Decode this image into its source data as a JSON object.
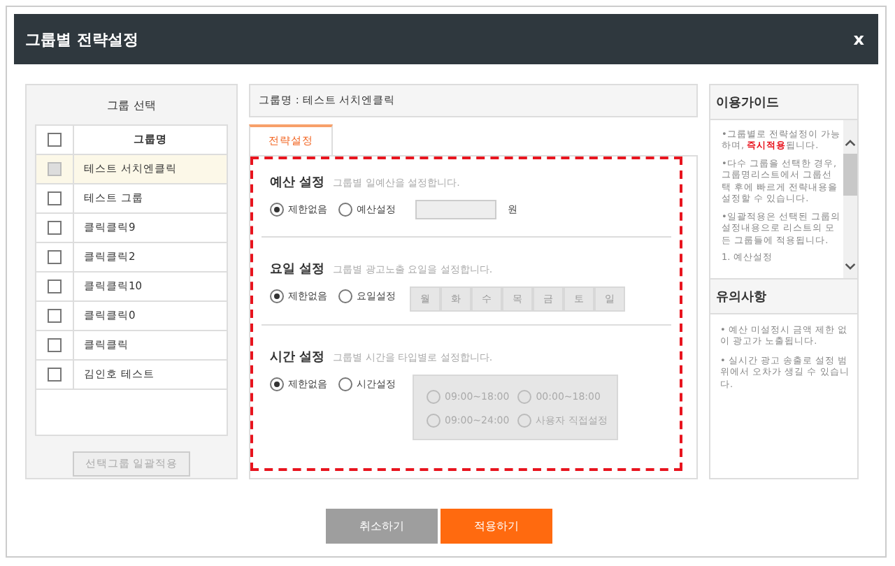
{
  "window": {
    "title": "그룹별 전략설정",
    "close": "x"
  },
  "group_panel": {
    "title": "그룹 선택",
    "header_checked": false,
    "column": "그룹명",
    "rows": [
      {
        "name": "테스트 서치엔클릭",
        "selected": true,
        "checked": false
      },
      {
        "name": "테스트 그룹",
        "selected": false,
        "checked": false
      },
      {
        "name": "클릭클릭9",
        "selected": false,
        "checked": false
      },
      {
        "name": "클릭클릭2",
        "selected": false,
        "checked": false
      },
      {
        "name": "클릭클릭10",
        "selected": false,
        "checked": false
      },
      {
        "name": "클릭클릭0",
        "selected": false,
        "checked": false
      },
      {
        "name": "클릭클릭",
        "selected": false,
        "checked": false
      },
      {
        "name": "김인호 테스트",
        "selected": false,
        "checked": false
      }
    ],
    "apply_button": {
      "label": "선택그룹 일괄적용",
      "disabled": true
    }
  },
  "strategy": {
    "group_name": "그룹명 : 테스트 서치엔클릭",
    "tabs": [
      {
        "label": "전략설정",
        "selected": true
      }
    ],
    "sections": [
      {
        "kind": "budget",
        "title": "예산 설정",
        "hint": "그룹별 일예산을 설정합니다.",
        "options": [
          {
            "label": "제한없음",
            "selected": true
          },
          {
            "label": "예산설정",
            "selected": false
          }
        ],
        "unit": "원"
      },
      {
        "kind": "days",
        "title": "요일 설정",
        "hint": "그룹별 광고노출 요일을 설정합니다.",
        "options": [
          {
            "label": "제한없음",
            "selected": true
          },
          {
            "label": "요일설정",
            "selected": false
          }
        ],
        "days": [
          {
            "label": "월",
            "selected": false
          },
          {
            "label": "화",
            "selected": false
          },
          {
            "label": "수",
            "selected": false
          },
          {
            "label": "목",
            "selected": false
          },
          {
            "label": "금",
            "selected": false
          },
          {
            "label": "토",
            "selected": false
          },
          {
            "label": "일",
            "selected": false
          }
        ]
      },
      {
        "kind": "time",
        "title": "시간 설정",
        "hint": "그룹별 시간을 타입별로 설정합니다.",
        "options": [
          {
            "label": "제한없음",
            "selected": true
          },
          {
            "label": "시간설정",
            "selected": false
          }
        ],
        "time_options": [
          {
            "label": "09:00~18:00",
            "selected": false
          },
          {
            "label": "00:00~18:00",
            "selected": false
          },
          {
            "label": "09:00~24:00",
            "selected": false
          },
          {
            "label": "사용자 직접설정",
            "selected": false
          }
        ]
      }
    ]
  },
  "guide": {
    "title": "이용가이드",
    "items": [
      "•그룹별로 전략설정이 가능하며, **즉시적용**됩니다.",
      "•다수 그룹을 선택한 경우, 그룹명리스트에서 그룹선택 후에 빠르게 전략내용을 설정할 수 있습니다.",
      "•일괄적용은 선택된 그룹의 설정내용으로 리스트의 모든 그룹들에 적용됩니다.",
      "1. 예산설정"
    ]
  },
  "notes": {
    "title": "유의사항",
    "items": [
      "• 예산 미설정시 금액 제한 없이 광고가 노출됩니다.",
      "• 실시간 광고 송출로 설정 범위에서 오차가 생길 수 있습니다."
    ]
  },
  "buttons": [
    {
      "kind": "cancel",
      "label": "취소하기"
    },
    {
      "kind": "apply",
      "label": "적용하기"
    }
  ]
}
